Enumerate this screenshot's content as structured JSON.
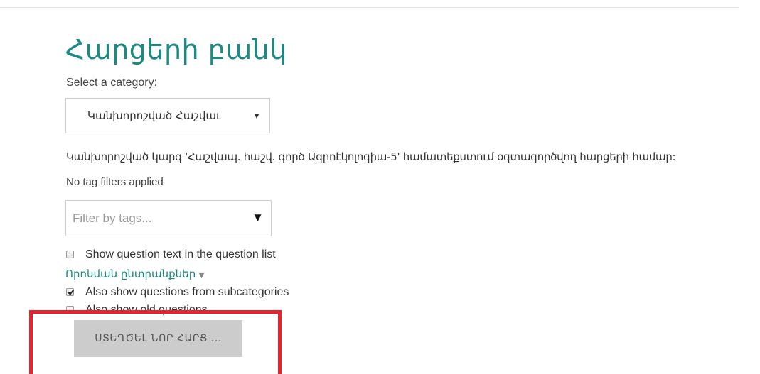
{
  "page": {
    "title": "Հարցերի բանկ"
  },
  "category": {
    "label": "Select a category:",
    "selected": "Կանխորոշված Հաշվաւ",
    "description": "Կանխորոշված կարգ 'Հաշվապ. հաշվ. գործ Ագրոէկոլոգիա-5' համատեքստում օգտագործվող հարցերի համար:"
  },
  "tags": {
    "status": "No tag filters applied",
    "placeholder": "Filter by tags..."
  },
  "options": {
    "show_text_label": "Show question text in the question list",
    "show_text_checked": false,
    "search_options_label": "Որոնման ընտրանքներ",
    "subcategories_label": "Also show questions from subcategories",
    "subcategories_checked": true,
    "old_questions_label": "Also show old questions",
    "old_questions_checked": false
  },
  "actions": {
    "create_label": "ՍՏԵՂԾԵԼ ՆՈՐ ՀԱՐՑ ..."
  },
  "colors": {
    "accent": "#1a8a83",
    "highlight": "#e8232b",
    "button_bg": "#cccccc"
  }
}
